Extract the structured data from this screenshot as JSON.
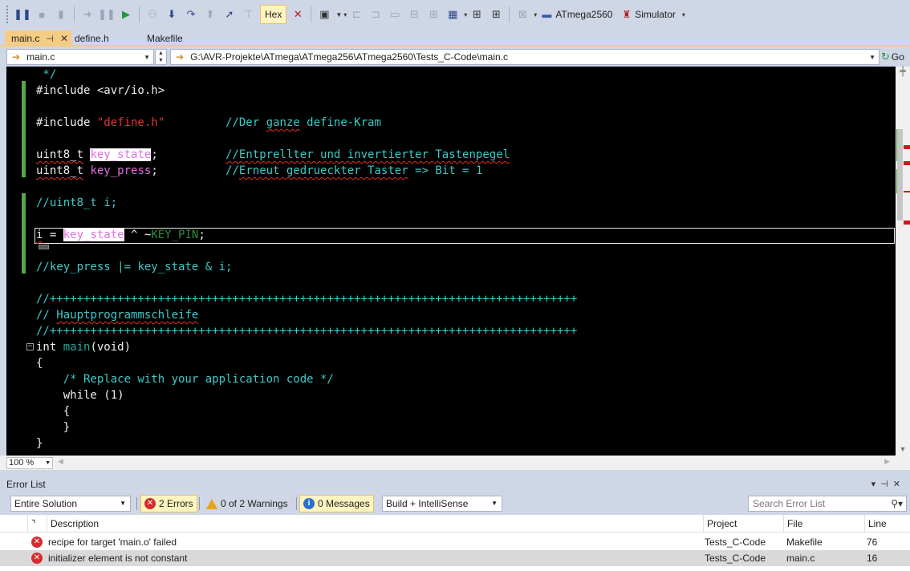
{
  "toolbar": {
    "hex_label": "Hex",
    "device_label": "ATmega2560",
    "tool_label": "Simulator"
  },
  "tabs": [
    {
      "label": "main.c"
    },
    {
      "label": "define.h"
    },
    {
      "label": "Makefile"
    }
  ],
  "nav": {
    "file_selector": "main.c",
    "path": "G:\\AVR-Projekte\\ATmega\\ATmega256\\ATmega2560\\Tests_C-Code\\main.c",
    "go_label": "Go"
  },
  "editor": {
    "zoom": "100 %",
    "lines": {
      "l0_comment_end": " */",
      "l1_include": "#include <avr/io.h>",
      "l3_include_kw": "#include ",
      "l3_include_str": "\"define.h\"",
      "l3_gap": "         ",
      "l3_comment": "//Der ganze define-Kram",
      "l5_type": "uint8_t",
      "l5_var": "key_state",
      "l5_semi": ";",
      "l5_gap": "          ",
      "l5_comment": "//Entprellter und invertierter Tastenpegel",
      "l6_type": "uint8_t",
      "l6_var": "key_press",
      "l6_semi": ";",
      "l6_gap": "          ",
      "l6_comment": "//Erneut gedrueckter Taster => Bit = 1",
      "l8_comment": "//uint8_t i;",
      "l10_i": "i",
      "l10_eq": " = ",
      "l10_var": "key_state",
      "l10_op": " ^ ~",
      "l10_macro": "KEY_PIN",
      "l10_semi": ";",
      "l12_comment_a": "//key_press ",
      "l12_comment_b": "|= key_state & i;",
      "l14_comment": "//++++++++++++++++++++++++++++++++++++++++++++++++++++++++++++++++++++++++++++++",
      "l15_comment": "// Hauptprogrammschleife",
      "l16_comment": "//++++++++++++++++++++++++++++++++++++++++++++++++++++++++++++++++++++++++++++++",
      "l17_int": "int ",
      "l17_func": "main",
      "l17_args": "(void)",
      "l18_brace": "{",
      "l19_comment": "    /* Replace with your application code */",
      "l20_while": "    while (1)",
      "l21_brace": "    {",
      "l22_brace": "    }",
      "l23_brace": "}"
    }
  },
  "error_list": {
    "title": "Error List",
    "scope": "Entire Solution",
    "errors_btn": "2 Errors",
    "warnings_btn": "0 of 2 Warnings",
    "messages_btn": "0 Messages",
    "build_filter": "Build + IntelliSense",
    "search_placeholder": "Search Error List",
    "columns": {
      "description": "Description",
      "project": "Project",
      "file": "File",
      "line": "Line"
    },
    "rows": [
      {
        "description": "recipe for target 'main.o' failed",
        "project": "Tests_C-Code",
        "file": "Makefile",
        "line": "76"
      },
      {
        "description": "initializer element is not constant",
        "project": "Tests_C-Code",
        "file": "main.c",
        "line": "16"
      }
    ]
  },
  "colors": {
    "chrome": "#cfd6e5",
    "active_tab": "#f5cc84",
    "editor_bg": "#000000",
    "comment": "#3fc8c8",
    "string": "#d63a3a",
    "identifier": "#e070e0",
    "error_icon": "#d42c2c"
  }
}
